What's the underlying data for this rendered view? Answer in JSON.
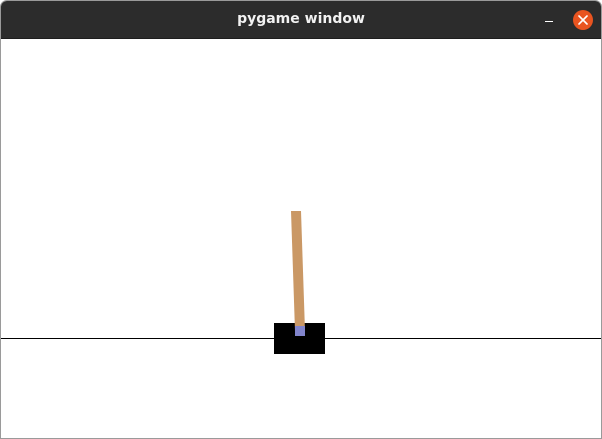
{
  "window": {
    "title": "pygame window",
    "buttons": {
      "minimize_icon": "minimize-icon",
      "close_icon": "close-icon"
    }
  },
  "scene": {
    "colors": {
      "background": "#ffffff",
      "track": "#000000",
      "cart": "#000000",
      "pole": "#ca9865",
      "axle": "#8184cb",
      "close_button": "#e95420",
      "titlebar": "#2c2c2c"
    }
  }
}
